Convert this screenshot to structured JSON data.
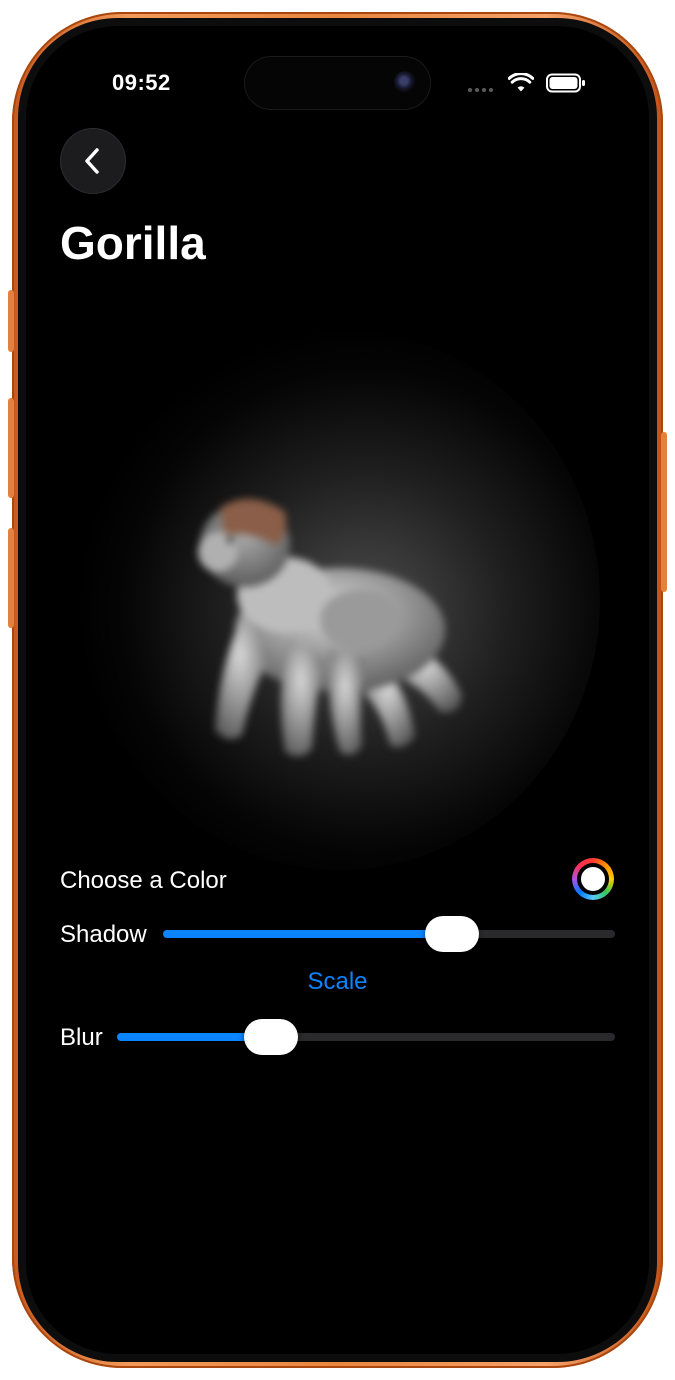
{
  "status_bar": {
    "time": "09:52",
    "icons": [
      "cellular-signal-icon",
      "wifi-icon",
      "battery-icon"
    ]
  },
  "nav": {
    "back_icon": "chevron-left-icon",
    "title": "Gorilla"
  },
  "hero": {
    "image": "gorilla-emoji-with-shadow"
  },
  "controls": {
    "color_label": "Choose a Color",
    "color_well_icon": "color-wheel-icon",
    "shadow_label": "Shadow",
    "shadow_value": 0.64,
    "scale_label": "Scale",
    "blur_label": "Blur",
    "blur_value": 0.31
  },
  "colors": {
    "accent": "#0a84ff",
    "background": "#000000",
    "frame": "#e9863f"
  }
}
